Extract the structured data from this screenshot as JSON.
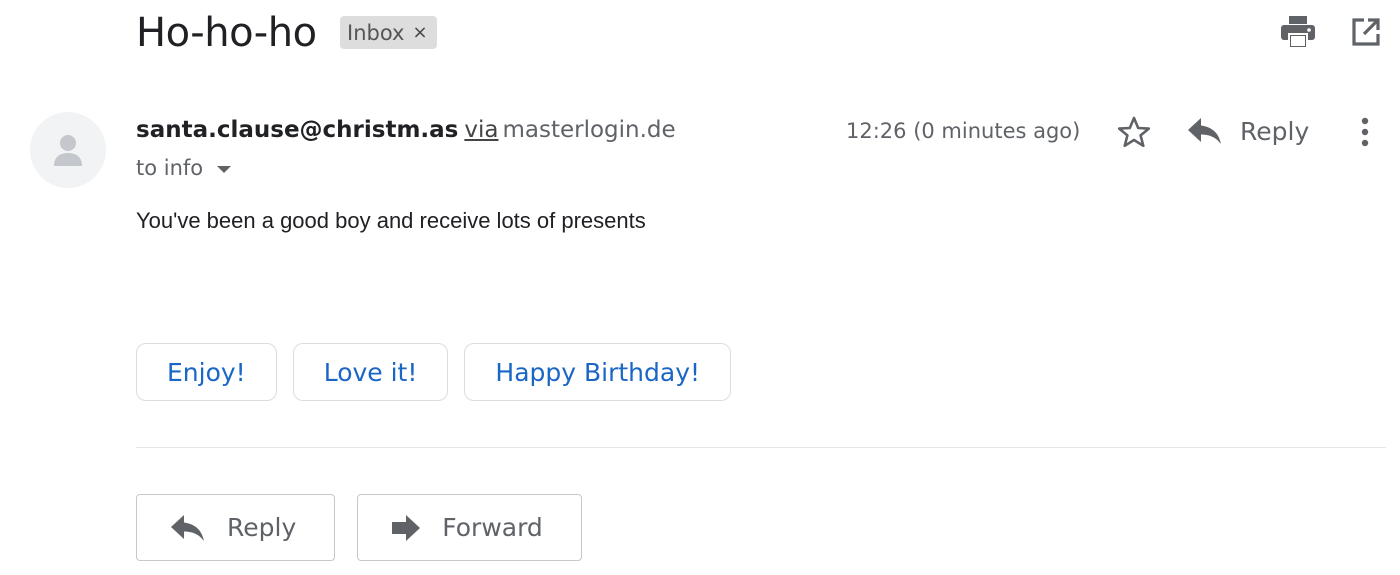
{
  "email": {
    "subject": "Ho-ho-ho",
    "label": "Inbox",
    "label_remove": "×",
    "sender": "santa.clause@christm.as",
    "via": "via",
    "via_domain": "masterlogin.de",
    "recipient": "to info",
    "time": "12:26 (0 minutes ago)",
    "reply_label": "Reply",
    "body": "You've been a good boy and receive lots of presents"
  },
  "icons": {
    "print": "print-icon",
    "open_new_window": "open-in-new-window-icon",
    "avatar": "person-icon",
    "star": "star-icon",
    "reply": "reply-icon",
    "more": "more-vert-icon",
    "forward": "forward-icon"
  },
  "smart_replies": [
    "Enjoy!",
    "Love it!",
    "Happy Birthday!"
  ],
  "actions": {
    "reply": "Reply",
    "forward": "Forward"
  },
  "colors": {
    "smart_reply_text": "#1a66c7",
    "label_chip_bg": "#dddddd",
    "icon_gray": "#5f6368"
  }
}
